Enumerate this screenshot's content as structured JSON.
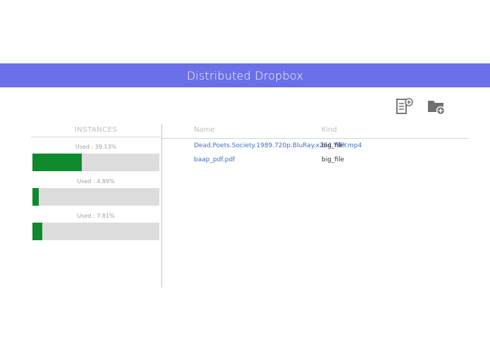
{
  "header": {
    "title": "Distributed Dropbox",
    "bg_color": "#6b6fe8"
  },
  "toolbar": {
    "new_file_icon": "new-file-icon",
    "new_folder_icon": "new-folder-icon"
  },
  "instances": {
    "title": "INSTANCES",
    "items": [
      {
        "used_label": "Used : 39.13%",
        "used_fraction": 0.3913
      },
      {
        "used_label": "Used : 4.89%",
        "used_fraction": 0.0489
      },
      {
        "used_label": "Used : 7.81%",
        "used_fraction": 0.0781
      }
    ],
    "bar_color": "#0f8a2d",
    "track_color": "#dcdcdc"
  },
  "files": {
    "columns": {
      "name": "Name",
      "kind": "Kind"
    },
    "rows": [
      {
        "name": "Dead.Poets.Society.1989.720p.BluRay.x264.YIFY.mp4",
        "kind": "big_file"
      },
      {
        "name": "baap_pdf.pdf",
        "kind": "big_file"
      }
    ]
  }
}
